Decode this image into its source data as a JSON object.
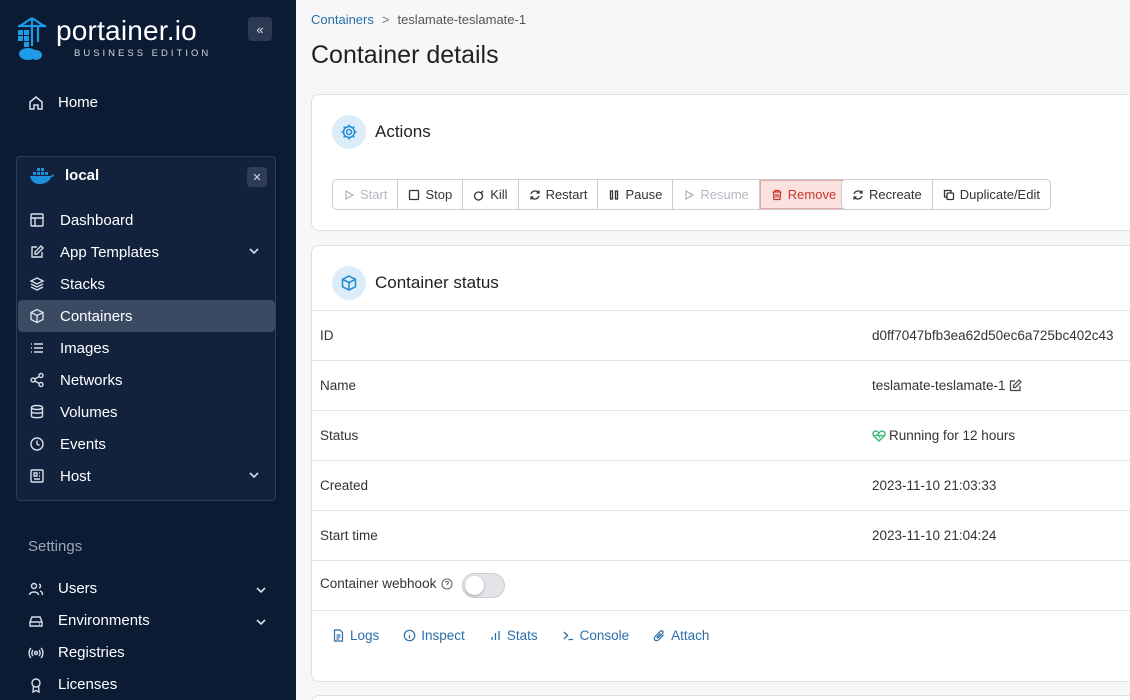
{
  "brand": {
    "name": "portainer.io",
    "edition": "BUSINESS EDITION"
  },
  "sidebar": {
    "collapse_glyph": "«",
    "home": "Home",
    "environment": {
      "name": "local",
      "close_glyph": "✕"
    },
    "env_items": [
      {
        "label": "Dashboard",
        "icon": "dashboard-icon"
      },
      {
        "label": "App Templates",
        "icon": "edit-icon",
        "expandable": true
      },
      {
        "label": "Stacks",
        "icon": "layers-icon"
      },
      {
        "label": "Containers",
        "icon": "box-icon",
        "active": true
      },
      {
        "label": "Images",
        "icon": "list-icon"
      },
      {
        "label": "Networks",
        "icon": "share-icon"
      },
      {
        "label": "Volumes",
        "icon": "database-icon"
      },
      {
        "label": "Events",
        "icon": "clock-icon"
      },
      {
        "label": "Host",
        "icon": "host-icon",
        "expandable": true
      }
    ],
    "settings_label": "Settings",
    "settings_items": [
      {
        "label": "Users",
        "expandable": true
      },
      {
        "label": "Environments",
        "expandable": true
      },
      {
        "label": "Registries"
      },
      {
        "label": "Licenses"
      }
    ]
  },
  "breadcrumb": {
    "parent": "Containers",
    "separator": ">",
    "current": "teslamate-teslamate-1"
  },
  "page_title": "Container details",
  "actions": {
    "title": "Actions",
    "buttons": {
      "start": "Start",
      "stop": "Stop",
      "kill": "Kill",
      "restart": "Restart",
      "pause": "Pause",
      "resume": "Resume",
      "remove": "Remove",
      "recreate": "Recreate",
      "duplicate": "Duplicate/Edit"
    }
  },
  "status_card": {
    "title": "Container status",
    "rows": {
      "id": {
        "label": "ID",
        "value": "d0ff7047bfb3ea62d50ec6a725bc402c43"
      },
      "name": {
        "label": "Name",
        "value": "teslamate-teslamate-1"
      },
      "status": {
        "label": "Status",
        "value": "Running for 12 hours"
      },
      "created": {
        "label": "Created",
        "value": "2023-11-10 21:03:33"
      },
      "start_time": {
        "label": "Start time",
        "value": "2023-11-10 21:04:24"
      },
      "webhook": {
        "label": "Container webhook",
        "enabled": false
      }
    },
    "links": {
      "logs": "Logs",
      "inspect": "Inspect",
      "stats": "Stats",
      "console": "Console",
      "attach": "Attach"
    }
  },
  "colors": {
    "sidebar_bg": "#0b1b34",
    "accent": "#1f8ad6",
    "link": "#2a6ea8",
    "danger": "#c6362c",
    "running": "#2bb673"
  }
}
